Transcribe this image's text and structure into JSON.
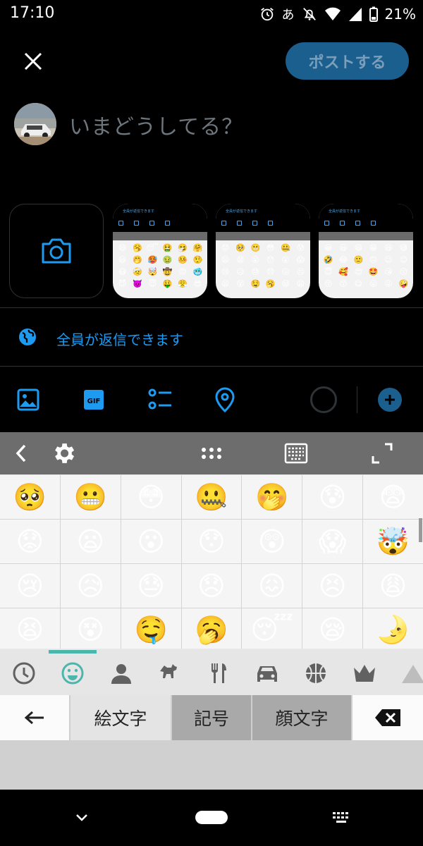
{
  "status_bar": {
    "time": "17:10",
    "ime": "あ",
    "battery": "21%"
  },
  "header": {
    "post_button": "ポストする",
    "close_icon": "close-icon"
  },
  "compose": {
    "placeholder": "いまどうしてる？"
  },
  "media": {
    "thumb_caption": "全員が返信できます",
    "thumbs": [
      [
        "😄",
        "🥱",
        "😴",
        "🤮",
        "🤧",
        "🤗",
        "😃",
        "🤭",
        "🥵",
        "🤢",
        "🤒",
        "🤥",
        "😷",
        "🤕",
        "🤯",
        "🤠",
        "😡",
        "🥶",
        "😈",
        "👿",
        "😇",
        "🤑",
        "😤",
        "😎"
      ],
      [
        "😟",
        "🥺",
        "😬",
        "😳",
        "🤐",
        "😰",
        "😦",
        "😧",
        "😮",
        "😯",
        "😲",
        "😱",
        "😢",
        "😥",
        "😓",
        "😞",
        "😖",
        "😣",
        "😫",
        "😵",
        "🤤",
        "🥱",
        "😪",
        "😩"
      ],
      [
        "😀",
        "😃",
        "😄",
        "😁",
        "😆",
        "😅",
        "🤣",
        "😂",
        "🙂",
        "🙃",
        "😉",
        "😊",
        "😇",
        "🥰",
        "😍",
        "🤩",
        "😘",
        "😗",
        "😚",
        "😙",
        "😋",
        "😛",
        "😜",
        "🤪"
      ]
    ]
  },
  "reply_setting": {
    "label": "全員が返信できます"
  },
  "emoji_rows": [
    [
      "🥺",
      "😬",
      "😳",
      "🤐",
      "🤭",
      "😰",
      "😨"
    ],
    [
      "😟",
      "😦",
      "😮",
      "😯",
      "😲",
      "😱",
      "🤯"
    ],
    [
      "😢",
      "😥",
      "😓",
      "😞",
      "😖",
      "😣",
      "😩"
    ],
    [
      "😫",
      "😵",
      "🤤",
      "🥱",
      "😴",
      "😪",
      "🌛"
    ]
  ],
  "keyboard_tabs": {
    "back": "←",
    "emoji": "絵文字",
    "symbols": "記号",
    "kaomoji": "顔文字"
  },
  "categories": [
    "clock-icon",
    "smiley-icon",
    "person-icon",
    "dog-icon",
    "food-icon",
    "car-icon",
    "ball-icon",
    "crown-icon",
    "triangle-icon"
  ],
  "colors": {
    "accent": "#1d9bf0",
    "post_button_bg": "#1b5f8f",
    "keyboard_bar": "#6d6d6d",
    "category_indicator": "#4db6ac"
  }
}
